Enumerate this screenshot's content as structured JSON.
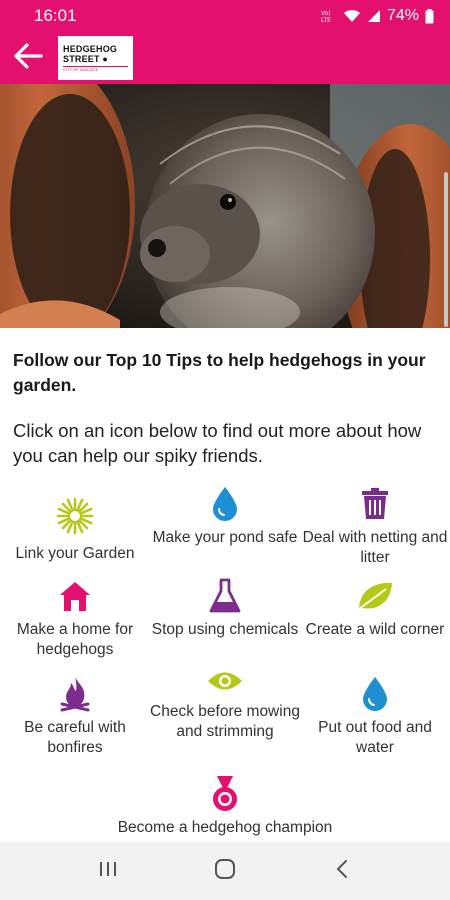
{
  "status_bar": {
    "time": "16:01",
    "battery": "74%"
  },
  "app_bar": {
    "logo_line1": "HEDGEHOG",
    "logo_line2": "STREET",
    "logo_sub": "CITY OF WILDLIFE"
  },
  "intro": {
    "title": "Follow our Top 10 Tips to help hedgehogs in your garden.",
    "text": "Click on an icon below to find out more about how you can help our spiky friends."
  },
  "tips": [
    {
      "label": "Link your Garden",
      "icon": "sun-flower-icon",
      "color": "#b5c919"
    },
    {
      "label": "Make your pond safe",
      "icon": "water-drop-icon",
      "color": "#1e8fd2"
    },
    {
      "label": "Deal with netting and litter",
      "icon": "trash-can-icon",
      "color": "#7b2d8e"
    },
    {
      "label": "Make a home for hedgehogs",
      "icon": "house-icon",
      "color": "#e4106f"
    },
    {
      "label": "Stop using chemicals",
      "icon": "flask-icon",
      "color": "#7b2d8e"
    },
    {
      "label": "Create a wild corner",
      "icon": "leaf-icon",
      "color": "#b5c919"
    },
    {
      "label": "Be careful with bonfires",
      "icon": "fire-icon",
      "color": "#7b2d8e"
    },
    {
      "label": "Check before mowing and strimming",
      "icon": "eye-icon",
      "color": "#b5c919"
    },
    {
      "label": "Put out food and water",
      "icon": "water-drop-icon",
      "color": "#1e8fd2"
    },
    {
      "label": "Become a hedgehog champion",
      "icon": "medal-icon",
      "color": "#e4106f"
    }
  ],
  "colors": {
    "brand": "#e4106f",
    "purple": "#7b2d8e",
    "green": "#b5c919",
    "blue": "#1e8fd2"
  }
}
